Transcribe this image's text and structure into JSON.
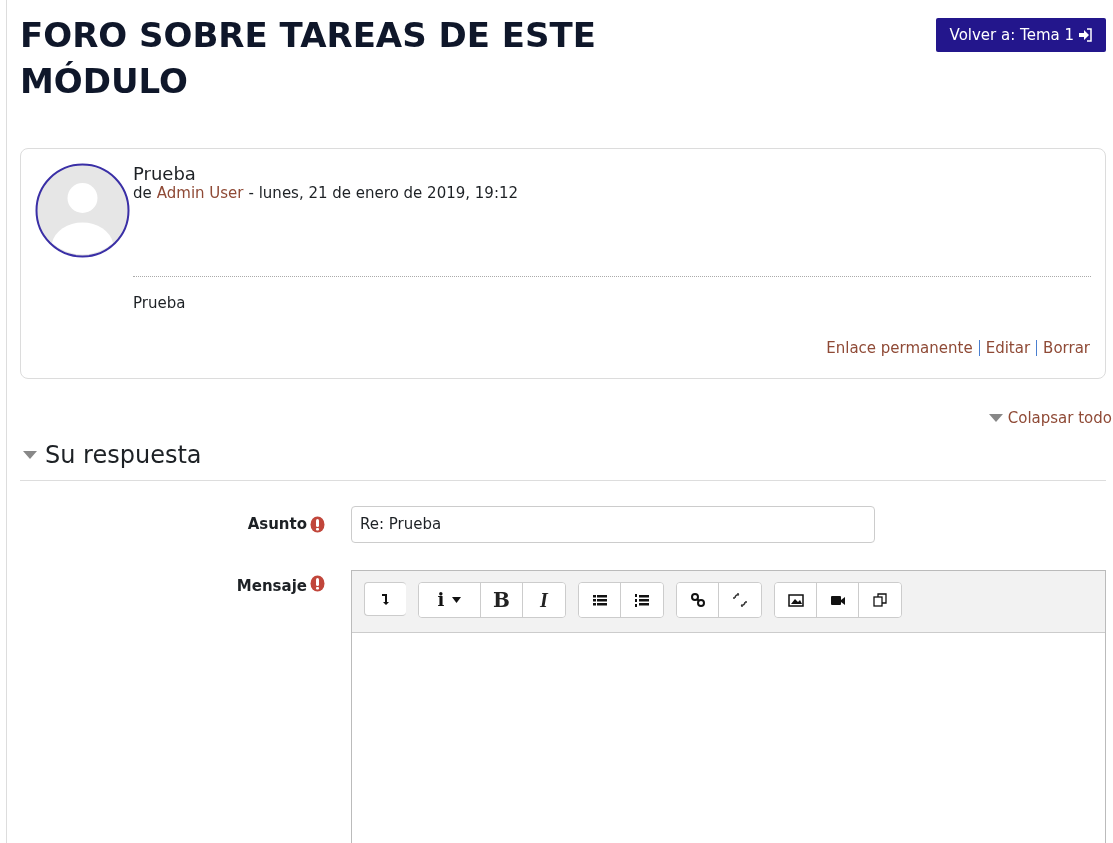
{
  "page": {
    "title": "FORO SOBRE TAREAS DE ESTE MÓDULO",
    "back_button": "Volver a: Tema 1"
  },
  "post": {
    "subject": "Prueba",
    "by": "de",
    "author": "Admin User",
    "date": "- lunes, 21 de enero de 2019, 19:12",
    "body": "Prueba",
    "links": [
      {
        "label": "Enlace permanente"
      },
      {
        "label": "Editar"
      },
      {
        "label": "Borrar"
      }
    ]
  },
  "collapse_all": "Colapsar todo",
  "section": {
    "title": "Su respuesta",
    "expanded": true
  },
  "form": {
    "subject_label": "Asunto",
    "subject_value": "Re: Prueba",
    "message_label": "Mensaje",
    "toolbar": [
      [
        {
          "kind": "expand"
        }
      ],
      [
        {
          "kind": "info",
          "label": "i"
        },
        {
          "kind": "bold",
          "label": "B"
        },
        {
          "kind": "italic",
          "label": "I"
        }
      ],
      [
        {
          "kind": "bullets"
        },
        {
          "kind": "numbers"
        }
      ],
      [
        {
          "kind": "link"
        },
        {
          "kind": "unlink"
        }
      ],
      [
        {
          "kind": "image"
        },
        {
          "kind": "video"
        },
        {
          "kind": "copy"
        }
      ]
    ]
  }
}
